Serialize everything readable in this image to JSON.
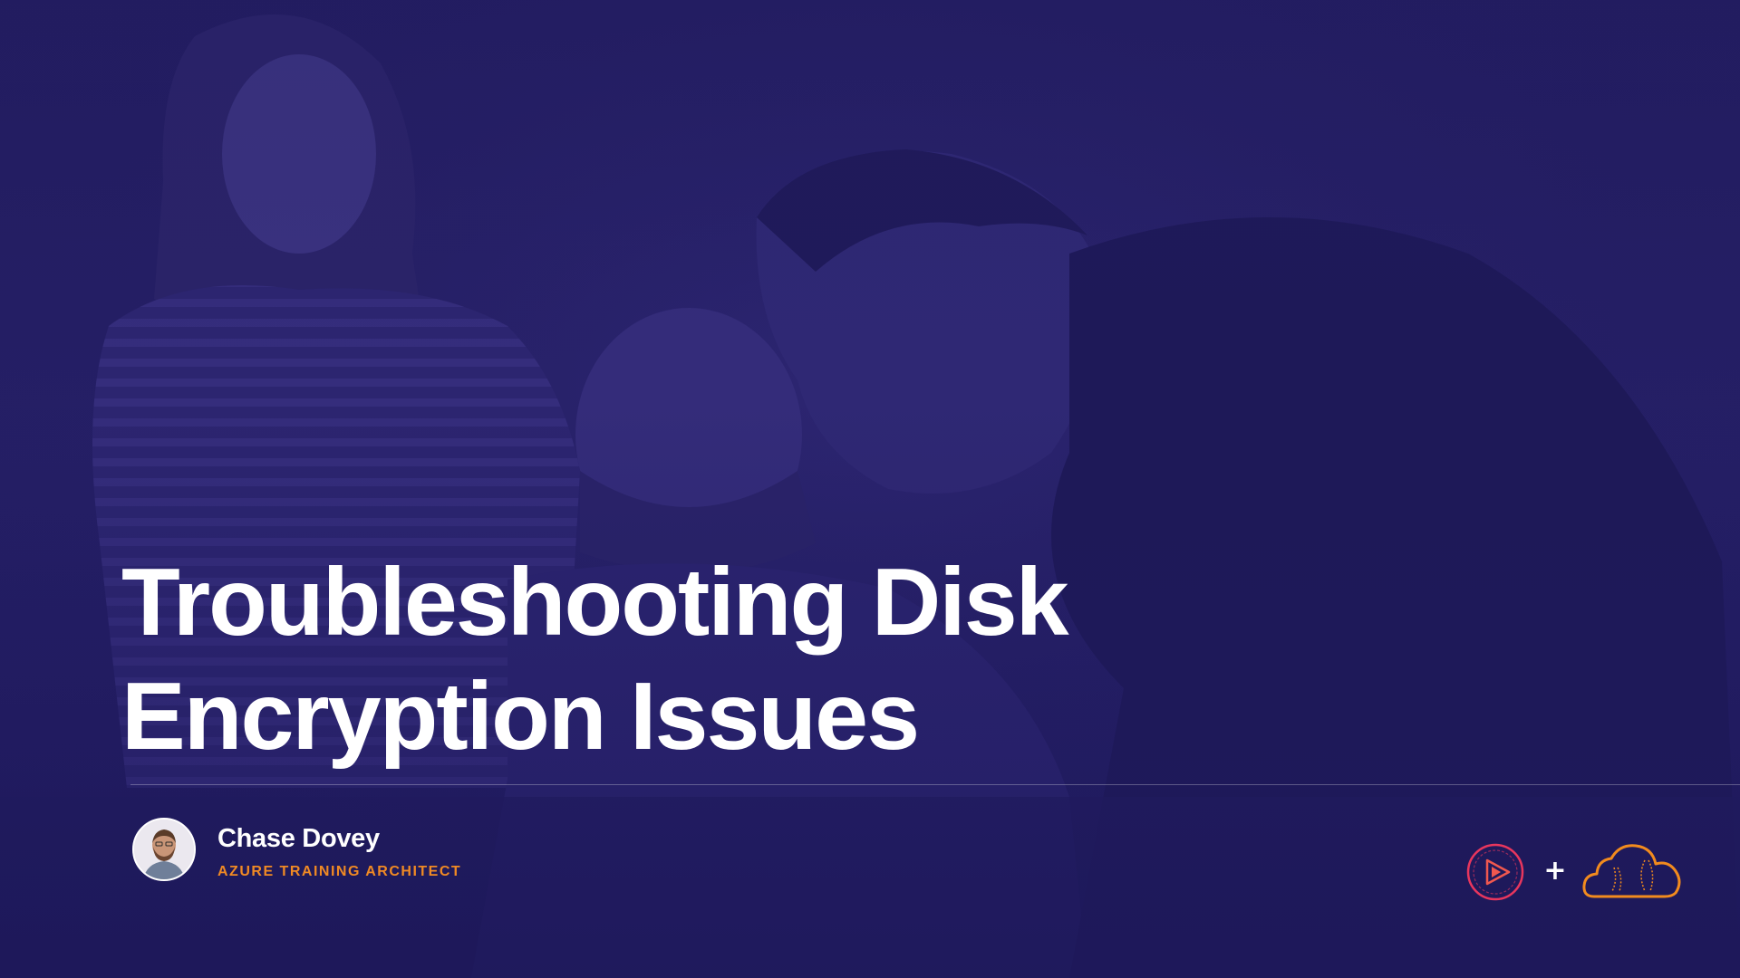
{
  "slide": {
    "title_line1": "Troubleshooting Disk",
    "title_line2": "Encryption Issues",
    "presenter": {
      "name": "Chase Dovey",
      "role": "AZURE TRAINING ARCHITECT"
    },
    "plus": "+"
  },
  "icons": {
    "avatar": "presenter-avatar",
    "logo_left": "pluralsight-play-logo",
    "logo_right": "cloud-guru-cloud-logo"
  },
  "colors": {
    "background": "#241e66",
    "title": "#ffffff",
    "role_accent": "#f08a24",
    "pluralsight_accent": "#e8365d",
    "acg_accent": "#f28b1e"
  }
}
